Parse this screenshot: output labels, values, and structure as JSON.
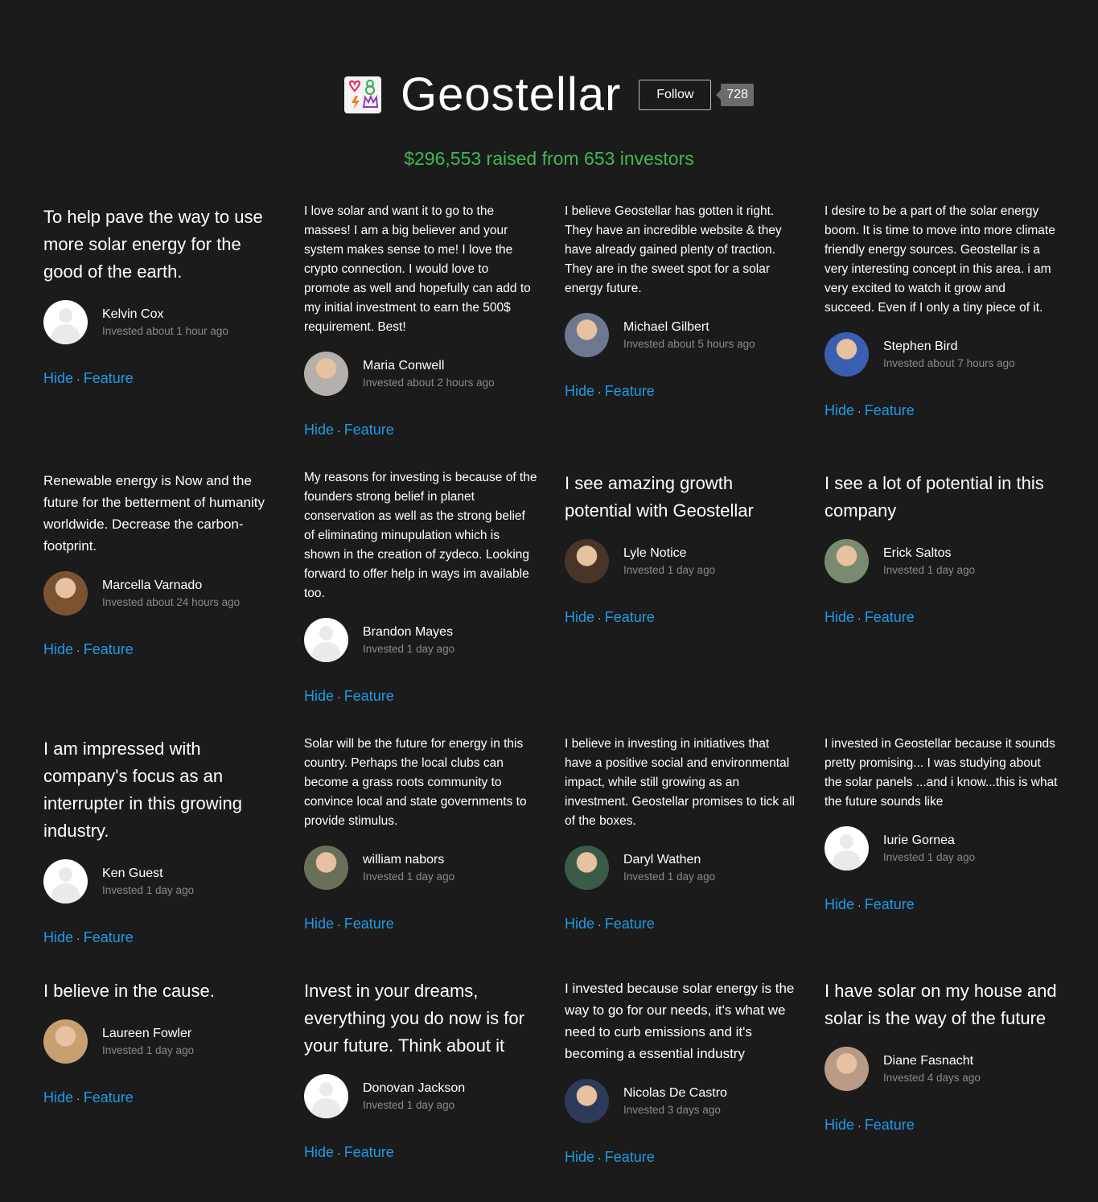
{
  "header": {
    "brand": "Geostellar",
    "follow_label": "Follow",
    "follower_count": "728",
    "raised": "$296,553 raised from 653 investors"
  },
  "actions": {
    "hide": "Hide",
    "feature": "Feature",
    "separator": "·"
  },
  "testimonials": [
    {
      "quote": "To help pave the way to use more solar energy for the good of the earth.",
      "name": "Kelvin Cox",
      "time": "Invested about 1 hour ago",
      "avatar_color": "#ffffff"
    },
    {
      "quote": "I love solar and want it to go to the masses! I am a big believer and your system makes sense to me! I love the crypto connection. I would love to promote as well and hopefully can add to my initial investment to earn the 500$ requirement. Best!",
      "name": "Maria Conwell",
      "time": "Invested about 2 hours ago",
      "avatar_color": "#b5b0ab"
    },
    {
      "quote": "I believe Geostellar has gotten it right. They have an incredible website & they have already gained plenty of traction. They are in the sweet spot for a solar energy future.",
      "name": "Michael Gilbert",
      "time": "Invested about 5 hours ago",
      "avatar_color": "#6d7890"
    },
    {
      "quote": "I desire to be a part of the solar energy boom. It is time to move into more climate friendly energy sources. Geostellar is a very interesting concept in this area. i am very excited to watch it grow and succeed. Even if I only a tiny piece of it.",
      "name": "Stephen Bird",
      "time": "Invested about 7 hours ago",
      "avatar_color": "#3a5fb0"
    },
    {
      "quote": "Renewable energy is Now and the future for the betterment of humanity worldwide. Decrease the carbon-footprint.",
      "name": "Marcella Varnado",
      "time": "Invested about 24 hours ago",
      "avatar_color": "#7a5430"
    },
    {
      "quote": "My reasons for investing is because of the founders strong belief in planet conservation as well as the strong belief of eliminating minupulation which is shown in the creation of zydeco. Looking forward to offer help in ways im available too.",
      "name": "Brandon Mayes",
      "time": "Invested 1 day ago",
      "avatar_color": "#ffffff"
    },
    {
      "quote": "I see amazing growth potential with Geostellar",
      "name": "Lyle Notice",
      "time": "Invested 1 day ago",
      "avatar_color": "#4a3428"
    },
    {
      "quote": "I see a lot of potential in this company",
      "name": "Erick Saltos",
      "time": "Invested 1 day ago",
      "avatar_color": "#7a8a70"
    },
    {
      "quote": "I am impressed with company's focus as an interrupter in this growing industry.",
      "name": "Ken Guest",
      "time": "Invested 1 day ago",
      "avatar_color": "#ffffff"
    },
    {
      "quote": "Solar will be the future for energy in this country. Perhaps the local clubs can become a grass roots community to convince local and state governments to provide stimulus.",
      "name": "william nabors",
      "time": "Invested 1 day ago",
      "avatar_color": "#6a7058"
    },
    {
      "quote": "I believe in investing in initiatives that have a positive social and environmental impact, while still growing as an investment. Geostellar promises to tick all of the boxes.",
      "name": "Daryl Wathen",
      "time": "Invested 1 day ago",
      "avatar_color": "#3c5a48"
    },
    {
      "quote": "I invested in Geostellar because it sounds pretty promising... I was studying about the solar panels ...and i know...this is what the future sounds like",
      "name": "Iurie Gornea",
      "time": "Invested 1 day ago",
      "avatar_color": "#ffffff"
    },
    {
      "quote": "I believe in the cause.",
      "name": "Laureen Fowler",
      "time": "Invested 1 day ago",
      "avatar_color": "#c8a070"
    },
    {
      "quote": "Invest in your dreams, everything you do now is for your future. Think about it",
      "name": "Donovan Jackson",
      "time": "Invested 1 day ago",
      "avatar_color": "#ffffff"
    },
    {
      "quote": "I invested because solar energy is the way to go for our needs, it's what we need to curb emissions and it's becoming a essential industry",
      "name": "Nicolas De Castro",
      "time": "Invested 3 days ago",
      "avatar_color": "#2e3a5a"
    },
    {
      "quote": "I have solar on my house and solar is the way of the future",
      "name": "Diane Fasnacht",
      "time": "Invested 4 days ago",
      "avatar_color": "#b89a86"
    }
  ]
}
